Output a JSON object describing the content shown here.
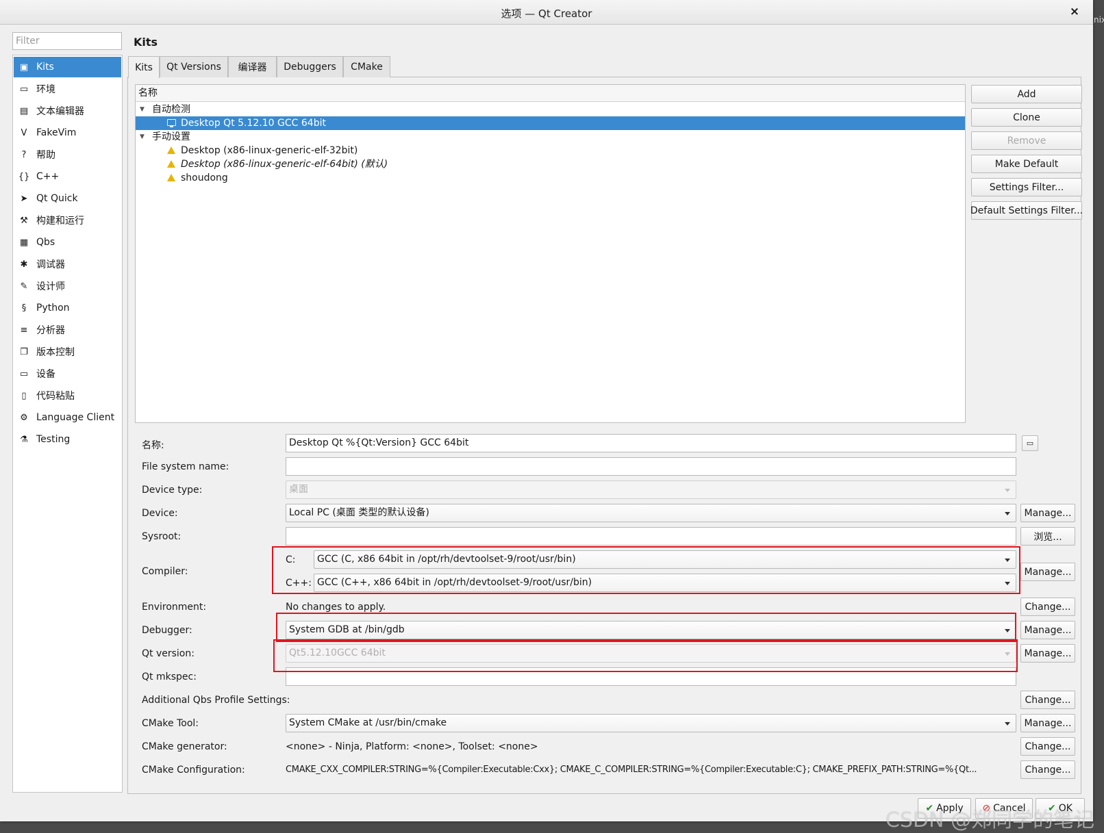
{
  "window": {
    "title": "选项 — Qt Creator",
    "close_glyph": "×",
    "edge_label": "nix"
  },
  "filter": {
    "placeholder": "Filter"
  },
  "sidebar": {
    "items": [
      {
        "label": "Kits",
        "icon": "kits-icon",
        "glyph": "▣"
      },
      {
        "label": "环境",
        "icon": "monitor-icon",
        "glyph": "▭"
      },
      {
        "label": "文本编辑器",
        "icon": "text-editor-icon",
        "glyph": "▤"
      },
      {
        "label": "FakeVim",
        "icon": "fakevim-icon",
        "glyph": "V"
      },
      {
        "label": "帮助",
        "icon": "help-icon",
        "glyph": "?"
      },
      {
        "label": "C++",
        "icon": "cpp-icon",
        "glyph": "{}"
      },
      {
        "label": "Qt Quick",
        "icon": "qt-quick-icon",
        "glyph": "➤"
      },
      {
        "label": "构建和运行",
        "icon": "hammer-icon",
        "glyph": "⚒"
      },
      {
        "label": "Qbs",
        "icon": "qbs-icon",
        "glyph": "▦"
      },
      {
        "label": "调试器",
        "icon": "bug-icon",
        "glyph": "✱"
      },
      {
        "label": "设计师",
        "icon": "pencil-icon",
        "glyph": "✎"
      },
      {
        "label": "Python",
        "icon": "python-icon",
        "glyph": "§"
      },
      {
        "label": "分析器",
        "icon": "analyzer-icon",
        "glyph": "≡"
      },
      {
        "label": "版本控制",
        "icon": "version-control-icon",
        "glyph": "❐"
      },
      {
        "label": "设备",
        "icon": "device-icon",
        "glyph": "▭"
      },
      {
        "label": "代码粘贴",
        "icon": "clipboard-icon",
        "glyph": "▯"
      },
      {
        "label": "Language Client",
        "icon": "language-client-icon",
        "glyph": "⚙"
      },
      {
        "label": "Testing",
        "icon": "testing-icon",
        "glyph": "⚗"
      }
    ]
  },
  "page": {
    "title": "Kits"
  },
  "tabs": [
    "Kits",
    "Qt Versions",
    "编译器",
    "Debuggers",
    "CMake"
  ],
  "tree": {
    "header": "名称",
    "groups": [
      {
        "label": "自动检测",
        "children": [
          "Desktop Qt 5.12.10 GCC 64bit"
        ]
      },
      {
        "label": "手动设置",
        "children": [
          "Desktop (x86-linux-generic-elf-32bit)",
          "Desktop (x86-linux-generic-elf-64bit) (默认)",
          "shoudong"
        ]
      }
    ]
  },
  "side_buttons": [
    "Add",
    "Clone",
    "Remove",
    "Make Default",
    "Settings Filter...",
    "Default Settings Filter..."
  ],
  "form": {
    "name_label": "名称:",
    "name_value": "Desktop Qt %{Qt:Version} GCC 64bit",
    "fsname_label": "File system name:",
    "fsname_value": "",
    "devtype_label": "Device type:",
    "devtype_value": "桌面",
    "device_label": "Device:",
    "device_value": "Local PC (桌面 类型的默认设备)",
    "device_btn": "Manage...",
    "sysroot_label": "Sysroot:",
    "sysroot_value": "",
    "sysroot_btn": "浏览...",
    "compiler_label": "Compiler:",
    "compiler_c_label": "C:",
    "compiler_c_value": "GCC (C, x86 64bit in /opt/rh/devtoolset-9/root/usr/bin)",
    "compiler_cpp_label": "C++:",
    "compiler_cpp_value": "GCC (C++, x86 64bit in /opt/rh/devtoolset-9/root/usr/bin)",
    "compiler_btn": "Manage...",
    "env_label": "Environment:",
    "env_value": "No changes to apply.",
    "env_btn": "Change...",
    "debugger_label": "Debugger:",
    "debugger_value": "System GDB at /bin/gdb",
    "debugger_btn": "Manage...",
    "qtver_label": "Qt version:",
    "qtver_value": "Qt5.12.10GCC 64bit",
    "qtver_btn": "Manage...",
    "mkspec_label": "Qt mkspec:",
    "mkspec_value": "",
    "qbs_label": "Additional Qbs Profile Settings:",
    "qbs_btn": "Change...",
    "cmake_tool_label": "CMake Tool:",
    "cmake_tool_value": "System CMake at /usr/bin/cmake",
    "cmake_tool_btn": "Manage...",
    "cmake_gen_label": "CMake generator:",
    "cmake_gen_value": "<none> - Ninja, Platform: <none>, Toolset: <none>",
    "cmake_gen_btn": "Change...",
    "cmake_cfg_label": "CMake Configuration:",
    "cmake_cfg_value": "CMAKE_CXX_COMPILER:STRING=%{Compiler:Executable:Cxx}; CMAKE_C_COMPILER:STRING=%{Compiler:Executable:C}; CMAKE_PREFIX_PATH:STRING=%{Qt...",
    "cmake_cfg_btn": "Change..."
  },
  "bottom": {
    "apply": "Apply",
    "cancel": "Cancel",
    "ok": "OK"
  },
  "watermark": "CSDN @郑同学的笔记",
  "colors": {
    "selection": "#3a8ad1",
    "highlight_box": "#e0141e",
    "warning": "#e8b400"
  }
}
